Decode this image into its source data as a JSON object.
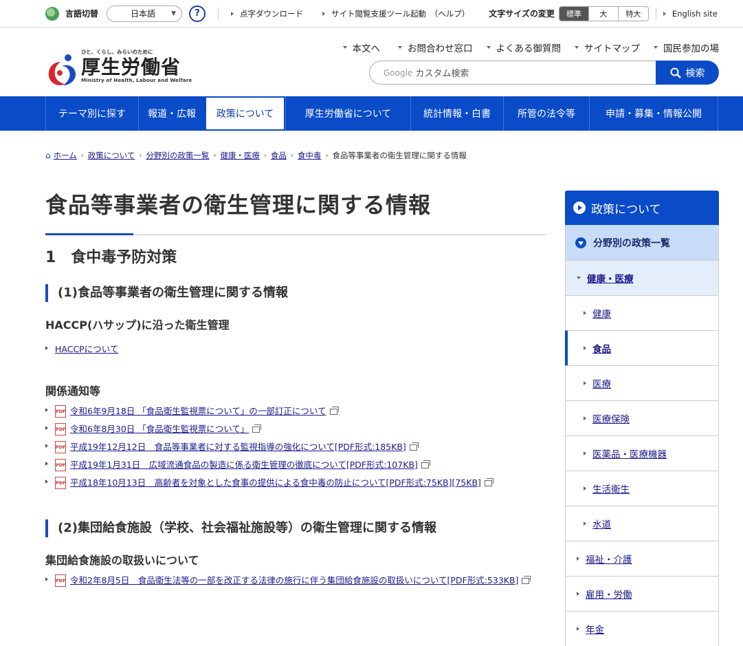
{
  "util": {
    "lang_label": "言語切替",
    "lang_value": "日本語",
    "help": "?",
    "braille": "点字ダウンロード",
    "reader": "サイト閲覧支援ツール起動　（ヘルプ）",
    "fontsize_label": "文字サイズの変更",
    "fontsize_options": [
      "標準",
      "大",
      "特大"
    ],
    "english": "English site"
  },
  "header": {
    "tagline": "ひと、くらし、みらいのために",
    "name": "厚生労働省",
    "name_en": "Ministry of Health, Labour and Welfare",
    "links": [
      "本文へ",
      "お問合わせ窓口",
      "よくある御質問",
      "サイトマップ",
      "国民参加の場"
    ],
    "search_prefix": "Google",
    "search_placeholder": "カスタム検索",
    "search_button": "検索"
  },
  "gnav": [
    "テーマ別に探す",
    "報道・広報",
    "政策について",
    "厚生労働省について",
    "統計情報・白書",
    "所管の法令等",
    "申請・募集・情報公開"
  ],
  "breadcrumb": [
    "ホーム",
    "政策について",
    "分野別の政策一覧",
    "健康・医療",
    "食品",
    "食中毒"
  ],
  "breadcrumb_current": "食品等事業者の衛生管理に関する情報",
  "main": {
    "title": "食品等事業者の衛生管理に関する情報",
    "h2": "1　食中毒予防対策",
    "s1_title": "(1)食品等事業者の衛生管理に関する情報",
    "s1_h4a": "HACCP(ハサップ)に沿った衛生管理",
    "s1_link": "HACCPについて",
    "s1_h4b": "関係通知等",
    "s1_pdfs": [
      "令和6年9月18日 「食品衛生監視票について」の一部訂正について",
      "令和6年8月30日 「食品衛生監視票について」",
      "平成19年12月12日　食品等事業者に対する監視指導の強化について[PDF形式:185KB]",
      "平成19年1月31日　広域流通食品の製造に係る衛生管理の徹底について[PDF形式:107KB]",
      "平成18年10月13日　高齢者を対象とした食事の提供による食中毒の防止について[PDF形式:75KB][75KB]"
    ],
    "s2_title": "(2)集団給食施設（学校、社会福祉施設等）の衛生管理に関する情報",
    "s2_h4": "集団給食施設の取扱いについて",
    "s2_pdf": "令和2年8月5日　食品衛生法等の一部を改正する法律の施行に伴う集団給食施設の取扱いについて[PDF形式:533KB]",
    "pdf_icon": "PDF"
  },
  "side": {
    "top": "政策について",
    "l2": "分野別の政策一覧",
    "l3": "健康・医療",
    "l4": [
      "健康",
      "食品",
      "医療",
      "医療保険",
      "医薬品・医療機器",
      "生活衛生",
      "水道"
    ],
    "others": [
      "福祉・介護",
      "雇用・労働",
      "年金"
    ]
  },
  "colors": {
    "brand": "#0a4bc7",
    "link": "#1a1a8c"
  }
}
